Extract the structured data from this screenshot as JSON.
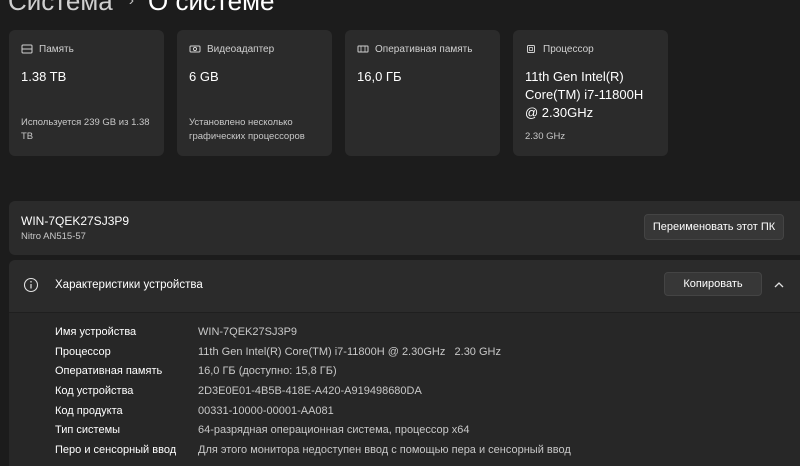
{
  "breadcrumb": {
    "parent": "Система",
    "separator": "›",
    "current": "О системе"
  },
  "cards": [
    {
      "icon": "storage-icon",
      "title": "Память",
      "value": "1.38 TB",
      "sub": "Используется 239 GB из 1.38 TB"
    },
    {
      "icon": "gpu-icon",
      "title": "Видеоадаптер",
      "value": "6 GB",
      "sub": "Установлено несколько графических процессоров"
    },
    {
      "icon": "ram-icon",
      "title": "Оперативная память",
      "value": "16,0 ГБ",
      "sub": ""
    },
    {
      "icon": "processor-icon",
      "title": "Процессор",
      "value": "11th Gen Intel(R) Core(TM) i7-11800H @ 2.30GHz",
      "sub": "2.30 GHz"
    }
  ],
  "pc": {
    "name": "WIN-7QEK27SJ3P9",
    "model": "Nitro AN515-57",
    "rename_label": "Переименовать этот ПК"
  },
  "specs": {
    "title": "Характеристики устройства",
    "copy_label": "Копировать",
    "rows": [
      {
        "label": "Имя устройства",
        "value": "WIN-7QEK27SJ3P9"
      },
      {
        "label": "Процессор",
        "value": "11th Gen Intel(R) Core(TM) i7-11800H @ 2.30GHz   2.30 GHz"
      },
      {
        "label": "Оперативная память",
        "value": "16,0 ГБ (доступно: 15,8 ГБ)"
      },
      {
        "label": "Код устройства",
        "value": "2D3E0E01-4B5B-418E-A420-A919498680DA"
      },
      {
        "label": "Код продукта",
        "value": "00331-10000-00001-AA081"
      },
      {
        "label": "Тип системы",
        "value": "64-разрядная операционная система, процессор x64"
      },
      {
        "label": "Перо и сенсорный ввод",
        "value": "Для этого монитора недоступен ввод с помощью пера и сенсорный ввод"
      }
    ]
  }
}
